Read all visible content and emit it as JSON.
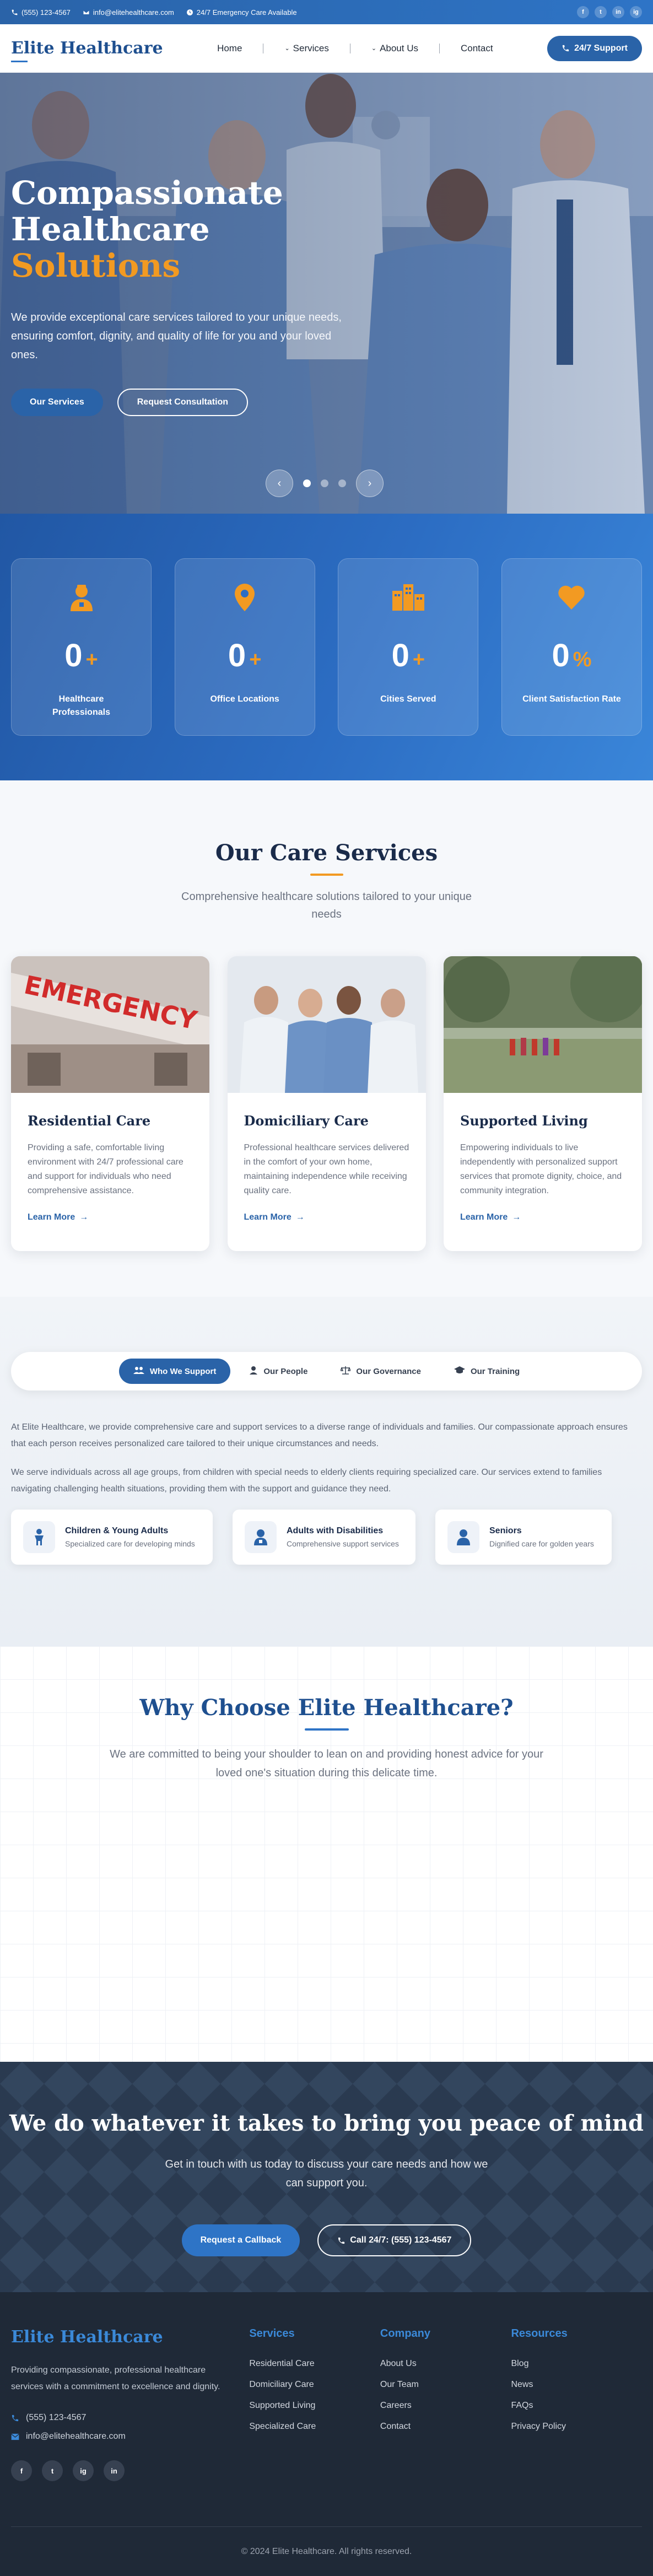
{
  "topbar": {
    "phone": "(555) 123-4567",
    "email": "info@elitehealthcare.com",
    "emergency": "24/7 Emergency Care Available",
    "social": [
      "f",
      "t",
      "in",
      "ig"
    ]
  },
  "header": {
    "brand": "Elite Healthcare",
    "nav": [
      "Home",
      "Services",
      "About Us",
      "Contact"
    ],
    "support_button": "24/7 Support"
  },
  "hero": {
    "title_line1": "Compassionate",
    "title_line2": "Healthcare",
    "title_accent": "Solutions",
    "text": "We provide exceptional care services tailored to your unique needs, ensuring comfort, dignity, and quality of life for you and your loved ones.",
    "primary_button": "Our Services",
    "secondary_button": "Request Consultation"
  },
  "stats": [
    {
      "icon": "user-nurse-icon",
      "value": "0",
      "suffix": "+",
      "label": "Healthcare Professionals"
    },
    {
      "icon": "location-pin-icon",
      "value": "0",
      "suffix": "+",
      "label": "Office Locations"
    },
    {
      "icon": "city-icon",
      "value": "0",
      "suffix": "+",
      "label": "Cities Served"
    },
    {
      "icon": "heart-icon",
      "value": "0",
      "suffix": "%",
      "label": "Client Satisfaction Rate"
    }
  ],
  "services": {
    "title": "Our Care Services",
    "subtitle": "Comprehensive healthcare solutions tailored to your unique needs",
    "cards": [
      {
        "name": "Residential Care",
        "desc": "Providing a safe, comfortable living environment with 24/7 professional care and support for individuals who need comprehensive assistance.",
        "link": "Learn More",
        "image_text": "EMERGENCY"
      },
      {
        "name": "Domiciliary Care",
        "desc": "Professional healthcare services delivered in the comfort of your own home, maintaining independence while receiving quality care.",
        "link": "Learn More"
      },
      {
        "name": "Supported Living",
        "desc": "Empowering individuals to live independently with personalized support services that promote dignity, choice, and community integration.",
        "link": "Learn More"
      }
    ]
  },
  "tabs": {
    "items": [
      "Who We Support",
      "Our People",
      "Our Governance",
      "Our Training"
    ],
    "paragraph1": "At Elite Healthcare, we provide comprehensive care and support services to a diverse range of individuals and families. Our compassionate approach ensures that each person receives personalized care tailored to their unique circumstances and needs.",
    "paragraph2": "We serve individuals across all age groups, from children with special needs to elderly clients requiring specialized care. Our services extend to families navigating challenging health situations, providing them with the support and guidance they need.",
    "groups": [
      {
        "title": "Children & Young Adults",
        "sub": "Specialized care for developing minds"
      },
      {
        "title": "Adults with Disabilities",
        "sub": "Comprehensive support services"
      },
      {
        "title": "Seniors",
        "sub": "Dignified care for golden years"
      }
    ]
  },
  "why": {
    "title": "Why Choose Elite Healthcare?",
    "subtitle": "We are committed to being your shoulder to lean on and providing honest advice for your loved one's situation during this delicate time."
  },
  "cta": {
    "title": "We do whatever it takes to bring you peace of mind",
    "text": "Get in touch with us today to discuss your care needs and how we can support you.",
    "primary_button": "Request a Callback",
    "secondary_button": "Call 24/7: (555) 123-4567"
  },
  "footer": {
    "brand": "Elite Healthcare",
    "about": "Providing compassionate, professional healthcare services with a commitment to excellence and dignity.",
    "phone": "(555) 123-4567",
    "email": "info@elitehealthcare.com",
    "social": [
      "f",
      "t",
      "ig",
      "in"
    ],
    "columns": [
      {
        "title": "Services",
        "links": [
          "Residential Care",
          "Domiciliary Care",
          "Supported Living",
          "Specialized Care"
        ]
      },
      {
        "title": "Company",
        "links": [
          "About Us",
          "Our Team",
          "Careers",
          "Contact"
        ]
      },
      {
        "title": "Resources",
        "links": [
          "Blog",
          "News",
          "FAQs",
          "Privacy Policy"
        ]
      }
    ],
    "copyright": "© 2024 Elite Healthcare. All rights reserved."
  }
}
